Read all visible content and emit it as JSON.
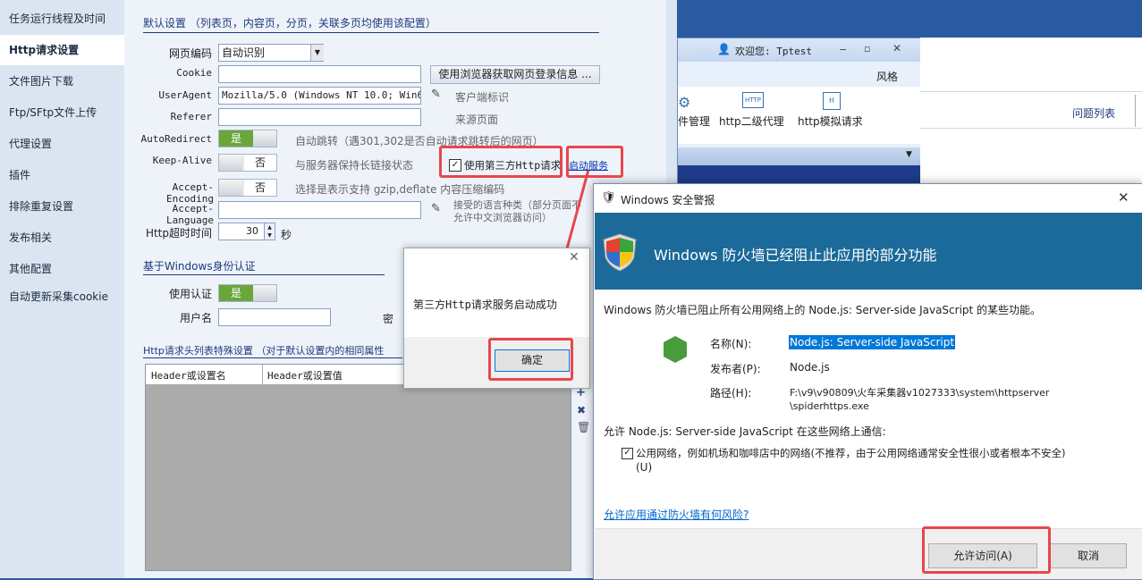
{
  "sidebar": {
    "items": [
      {
        "label": "任务运行线程及时间",
        "active": false
      },
      {
        "label": "Http请求设置",
        "active": true
      },
      {
        "label": "文件图片下载",
        "active": false
      },
      {
        "label": "Ftp/SFtp文件上传",
        "active": false
      },
      {
        "label": "代理设置",
        "active": false
      },
      {
        "label": "插件",
        "active": false
      },
      {
        "label": "排除重复设置",
        "active": false
      },
      {
        "label": "发布相关",
        "active": false
      },
      {
        "label": "其他配置",
        "active": false
      },
      {
        "label": "自动更新采集cookie",
        "active": false
      }
    ]
  },
  "settings": {
    "default_title": "默认设置 （列表页，内容页，分页，关联多页均使用该配置）",
    "encoding_label": "网页编码",
    "encoding_value": "自动识别",
    "cookie_label": "Cookie",
    "cookie_button": "使用浏览器获取网页登录信息 ...",
    "ua_label": "UserAgent",
    "ua_value": "Mozilla/5.0 (Windows NT 10.0; Win64;",
    "ua_hint": "客户端标识",
    "referer_label": "Referer",
    "referer_hint": "来源页面",
    "autoredirect_label": "AutoRedirect",
    "autoredirect_value": "是",
    "autoredirect_hint": "自动跳转（遇301,302是否自动请求跳转后的网页）",
    "keepalive_label": "Keep-Alive",
    "keepalive_value": "否",
    "keepalive_hint": "与服务器保持长链接状态",
    "third_party_checkbox": "使用第三方Http请求",
    "start_service_link": "启动服务",
    "accept_encoding_label": "Accept-Encoding",
    "accept_encoding_value": "否",
    "accept_encoding_hint": "选择是表示支持 gzip,deflate 内容压缩编码",
    "accept_language_label": "Accept-Language",
    "accept_language_hint1": "接受的语言种类（部分页面不",
    "accept_language_hint2": "允许中文浏览器访问）",
    "timeout_label": "Http超时时间",
    "timeout_value": "30",
    "timeout_unit": "秒",
    "auth_title": "基于Windows身份认证",
    "use_auth_label": "使用认证",
    "use_auth_value": "是",
    "username_label": "用户名",
    "password_label_partial": "密",
    "headers_title": "Http请求头列表特殊设置 （对于默认设置内的相同属性",
    "headers_col1": "Header或设置名",
    "headers_col2": "Header或设置值"
  },
  "bg_window": {
    "welcome": "欢迎您: Tptest",
    "style_menu": "风格",
    "tool1": "件管理",
    "tool2": "http二级代理",
    "tool3": "http模拟请求",
    "right_tab": "问题列表"
  },
  "small_dialog": {
    "message": "第三方Http请求服务启动成功",
    "ok_button": "确定"
  },
  "firewall_dialog": {
    "title": "Windows 安全警报",
    "banner": "Windows 防火墙已经阻止此应用的部分功能",
    "desc": "Windows 防火墙已阻止所有公用网络上的 Node.js: Server-side JavaScript 的某些功能。",
    "name_label": "名称(N):",
    "name_value": "Node.js: Server-side JavaScript",
    "publisher_label": "发布者(P):",
    "publisher_value": "Node.js",
    "path_label": "路径(H):",
    "path_value1": "F:\\v9\\v90809\\火车采集器v1027333\\system\\httpserver",
    "path_value2": "\\spiderhttps.exe",
    "allow_text": "允许 Node.js: Server-side JavaScript 在这些网络上通信:",
    "public_network": "公用网络，例如机场和咖啡店中的网络(不推荐，由于公用网络通常安全性很小或者根本不安全)",
    "public_network_key": "(U)",
    "risk_link": "允许应用通过防火墙有何风险?",
    "allow_button": "允许访问(A)",
    "cancel_button": "取消"
  },
  "colors": {
    "accent": "#1f3a7a",
    "highlight": "#e8464f",
    "banner": "#1b6a99"
  }
}
